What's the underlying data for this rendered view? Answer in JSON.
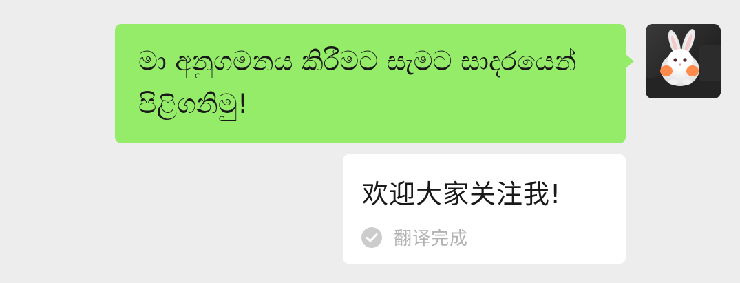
{
  "messages": [
    {
      "sender": "self",
      "text": "මා අනුගමනය කිරීමට සැමට සාදරයෙන් පිළිගනිමු!",
      "bubble_color": "#95ec69",
      "translation": {
        "text": "欢迎大家关注我!",
        "status_label": "翻译完成",
        "status_icon": "check-circle-icon"
      }
    }
  ],
  "colors": {
    "background": "#ededed",
    "self_bubble": "#95ec69",
    "translation_bubble": "#ffffff",
    "status_gray": "#b2b2b2"
  },
  "avatar": {
    "icon": "avatar-rabbit"
  }
}
